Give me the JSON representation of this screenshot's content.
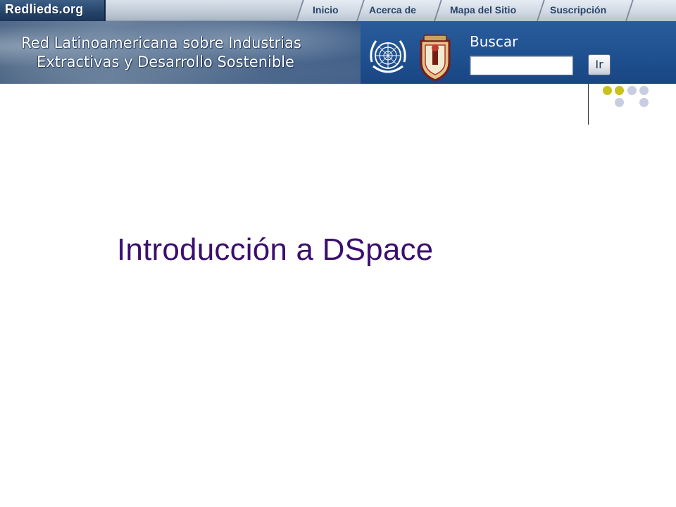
{
  "topbar": {
    "brand": "Redlieds.org",
    "nav": [
      {
        "label": "Inicio"
      },
      {
        "label": "Acerca de"
      },
      {
        "label": "Mapa del Sitio"
      },
      {
        "label": "Suscripción"
      }
    ]
  },
  "header": {
    "title_line1": "Red Latinoamericana sobre Industrias",
    "title_line2": "Extractivas y Desarrollo Sostenible",
    "logos": [
      "un-emblem-icon",
      "university-crest-icon"
    ],
    "search": {
      "label": "Buscar",
      "value": "",
      "button_label": "Ir"
    }
  },
  "decoration": {
    "accent_color": "#c8c21e",
    "muted_color": "#c9cde0"
  },
  "slide": {
    "title": "Introducción a DSpace",
    "title_color": "#3b0f6e"
  }
}
